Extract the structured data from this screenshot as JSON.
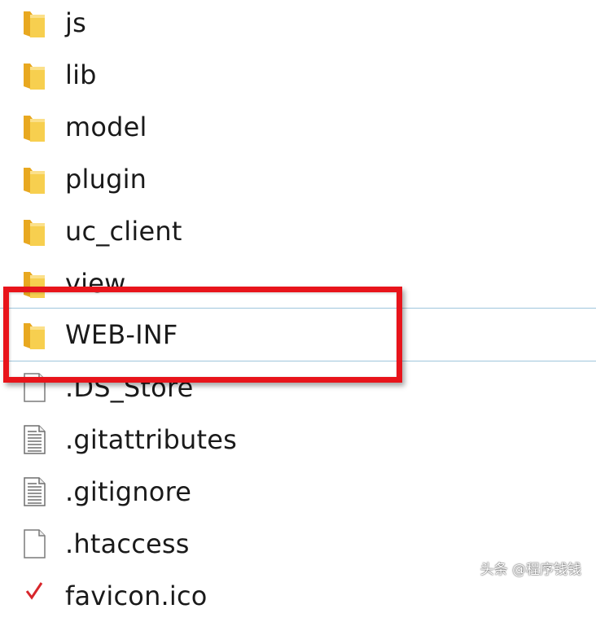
{
  "files": [
    {
      "name": "js",
      "type": "folder"
    },
    {
      "name": "lib",
      "type": "folder"
    },
    {
      "name": "model",
      "type": "folder"
    },
    {
      "name": "plugin",
      "type": "folder"
    },
    {
      "name": "uc_client",
      "type": "folder"
    },
    {
      "name": "view",
      "type": "folder"
    },
    {
      "name": "WEB-INF",
      "type": "folder",
      "selected": true
    },
    {
      "name": ".DS_Store",
      "type": "file"
    },
    {
      "name": ".gitattributes",
      "type": "text-file"
    },
    {
      "name": ".gitignore",
      "type": "text-file"
    },
    {
      "name": ".htaccess",
      "type": "file"
    },
    {
      "name": "favicon.ico",
      "type": "image-file"
    }
  ],
  "watermark": "头条 @程序钱钱",
  "colors": {
    "folder": "#f5c842",
    "highlight_border": "#e8141b",
    "selection_line": "#9fc6dc"
  },
  "icons": {
    "folder": "folder-icon",
    "file": "file-icon",
    "text-file": "text-file-icon",
    "image-file": "image-file-icon"
  }
}
